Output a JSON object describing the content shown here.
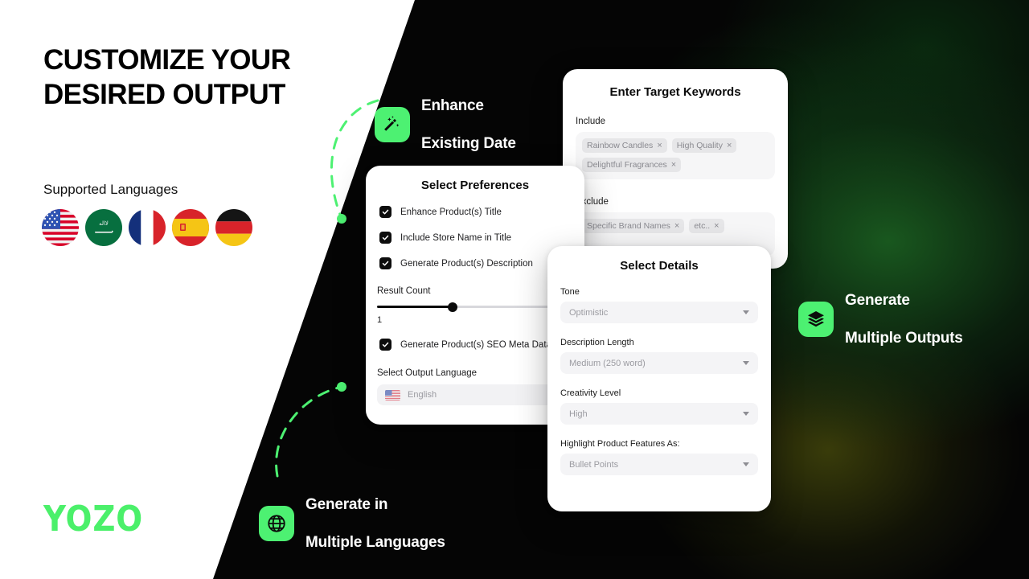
{
  "brand": {
    "logo_text": "YOZO",
    "accent_green": "#4DF172",
    "logo_green": "#4BF06A",
    "dark_bg": "#050505"
  },
  "left_panel": {
    "headline": "CUSTOMIZE YOUR\nDESIRED OUTPUT",
    "headline_line1": "CUSTOMIZE YOUR",
    "headline_line2": "DESIRED OUTPUT",
    "supported_languages_label": "Supported Languages",
    "flags": [
      {
        "name": "flag-united-states",
        "label": "United States"
      },
      {
        "name": "flag-saudi-arabia",
        "label": "Saudi Arabia"
      },
      {
        "name": "flag-france",
        "label": "France"
      },
      {
        "name": "flag-spain",
        "label": "Spain"
      },
      {
        "name": "flag-germany",
        "label": "Germany"
      }
    ]
  },
  "features": [
    {
      "id": "enhance",
      "icon": "magic-wand-icon",
      "text": "Enhance\nExisting Date",
      "line1": "Enhance",
      "line2": "Existing Date"
    },
    {
      "id": "languages",
      "icon": "globe-icon",
      "text": "Generate in\nMultiple Languages",
      "line1": "Generate in",
      "line2": "Multiple Languages"
    },
    {
      "id": "outputs",
      "icon": "layers-icon",
      "text": "Generate\nMultiple Outputs",
      "line1": "Generate",
      "line2": "Multiple Outputs"
    }
  ],
  "keywords_card": {
    "title": "Enter Target Keywords",
    "include_label": "Include",
    "include_chips": [
      "Rainbow Candles",
      "High Quality",
      "Delightful Fragrances"
    ],
    "exclude_label": "Exclude",
    "exclude_chips": [
      "Specific Brand Names",
      "etc.."
    ],
    "chip_remove_glyph": "×"
  },
  "preferences_card": {
    "title": "Select Preferences",
    "checkboxes": [
      {
        "label": "Enhance Product(s) Title",
        "checked": true
      },
      {
        "label": "Include Store Name in Title",
        "checked": true
      },
      {
        "label": "Generate Product(s) Description",
        "checked": true
      }
    ],
    "result_count_label": "Result Count",
    "result_count_value": "1",
    "seo_checkbox": {
      "label": "Generate Product(s) SEO Meta Data",
      "checked": true
    },
    "output_language_label": "Select Output Language",
    "output_language_value": "English"
  },
  "details_card": {
    "title": "Select Details",
    "fields": [
      {
        "label": "Tone",
        "value": "Optimistic"
      },
      {
        "label": "Description Length",
        "value": "Medium (250 word)"
      },
      {
        "label": "Creativity Level",
        "value": "High"
      },
      {
        "label": "Highlight Product Features As:",
        "value": "Bullet Points"
      }
    ]
  }
}
